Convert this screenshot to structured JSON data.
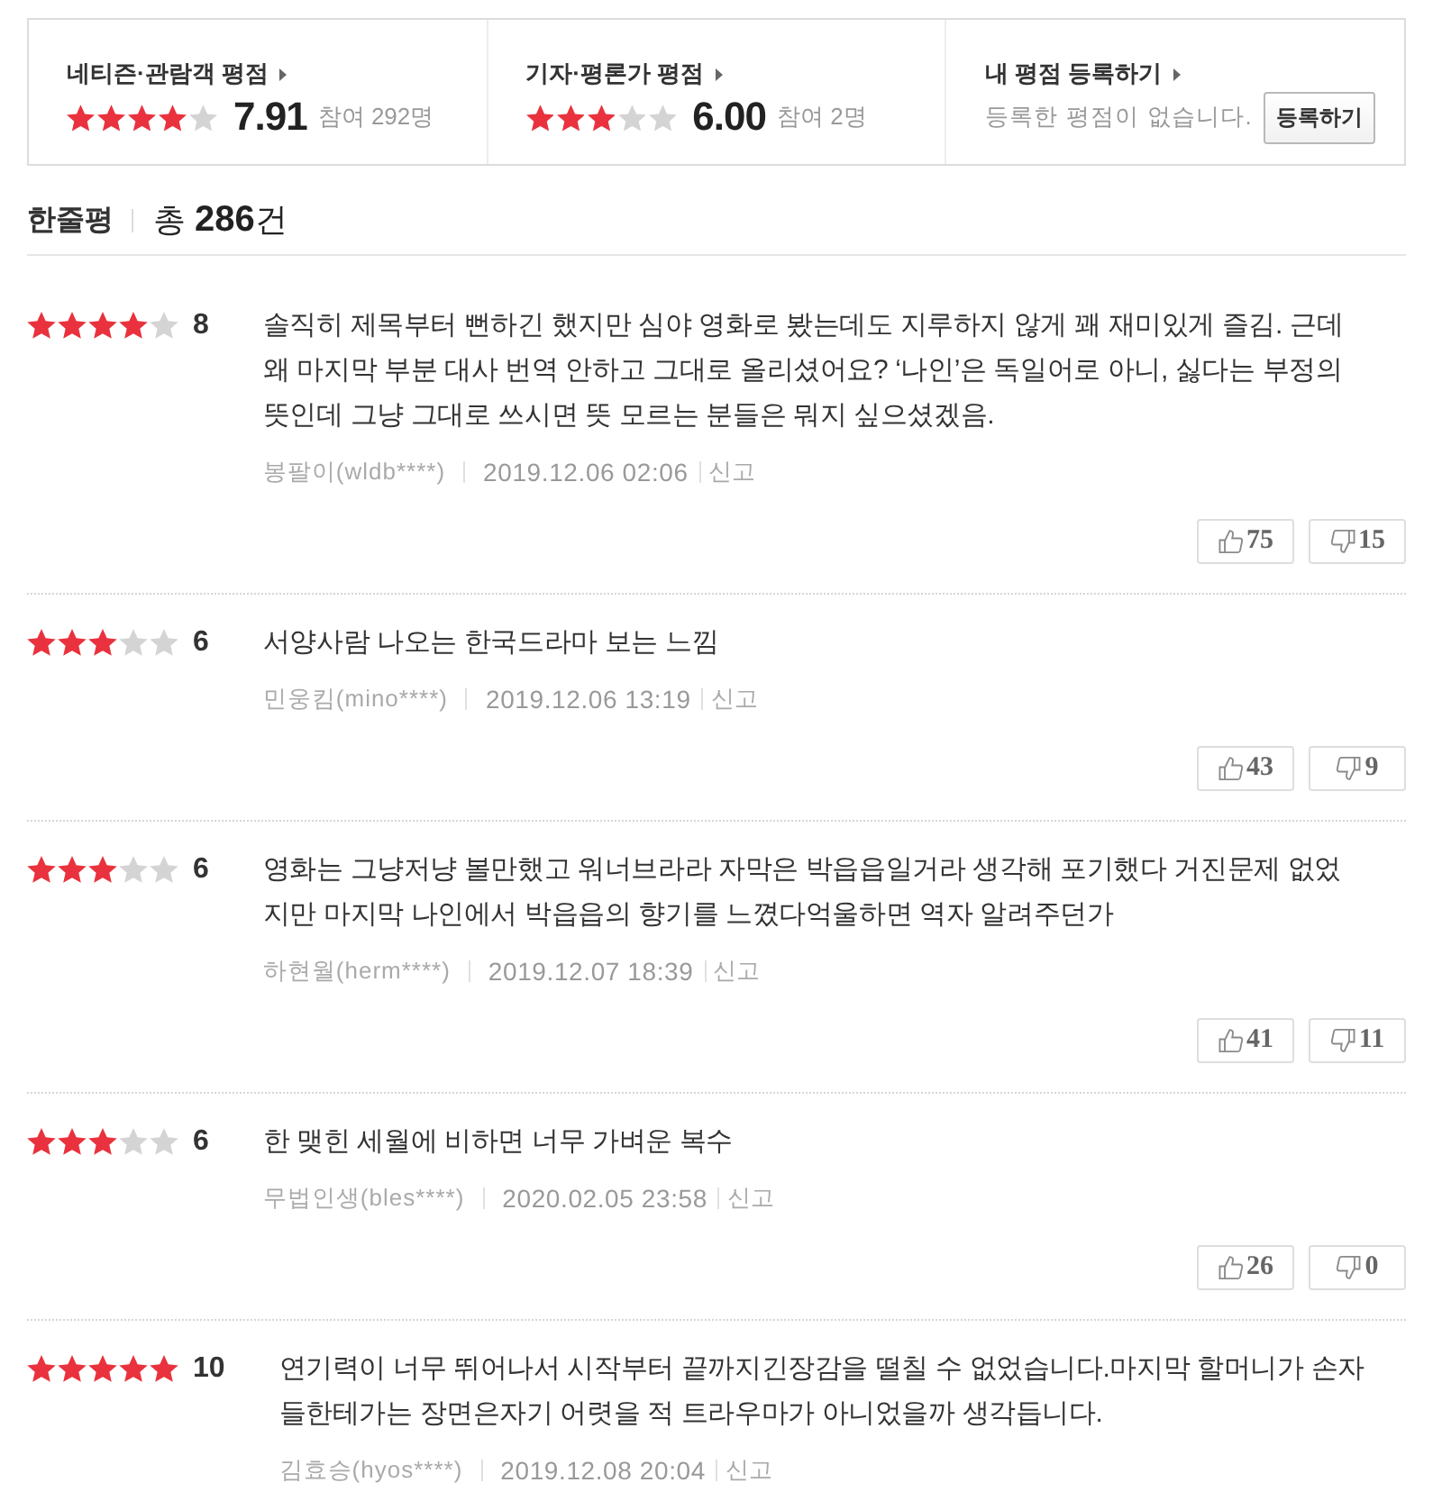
{
  "rating_summary": [
    {
      "title": "네티즌·관람객 평점",
      "stars": 4,
      "score": "7.91",
      "participants": "참여 292명"
    },
    {
      "title": "기자·평론가 평점",
      "stars": 3,
      "score": "6.00",
      "participants": "참여 2명"
    }
  ],
  "my_rating": {
    "title": "내 평점 등록하기",
    "message": "등록한 평점이 없습니다.",
    "button": "등록하기"
  },
  "reviews_header": {
    "title": "한줄평",
    "total": "총 **286**건"
  },
  "reviews": [
    {
      "stars": 4,
      "score": "8",
      "text": "솔직히 제목부터 뻔하긴 했지만 심야 영화로 봤는데도 지루하지 않게 꽤 재미있게 즐김. 근데 왜 마지막 부분 대사 번역 안하고 그대로 올리셨어요? ‘나인’은 독일어로 아니, 싫다는 부정의 뜻인데 그냥 그대로 쓰시면 뜻 모르는 분들은 뭐지 싶으셨겠음.",
      "author": "봉팔이(wldb****)",
      "date": "2019.12.06 02:06",
      "report": "신고",
      "likes": "75",
      "dislikes": "15"
    },
    {
      "stars": 3,
      "score": "6",
      "text": "서양사람 나오는 한국드라마 보는 느낌",
      "author": "민웅킴(mino****)",
      "date": "2019.12.06 13:19",
      "report": "신고",
      "likes": "43",
      "dislikes": "9"
    },
    {
      "stars": 3,
      "score": "6",
      "text": "영화는 그냥저냥 볼만했고 워너브라라 자막은 박읍읍일거라 생각해 포기했다 거진문제 없었지만 마지막 나인에서 박읍읍의 향기를 느꼈다억울하면 역자 알려주던가",
      "author": "하현월(herm****)",
      "date": "2019.12.07 18:39",
      "report": "신고",
      "likes": "41",
      "dislikes": "11"
    },
    {
      "stars": 3,
      "score": "6",
      "text": "한 맺힌 세월에 비하면 너무 가벼운 복수",
      "author": "무법인생(bles****)",
      "date": "2020.02.05 23:58",
      "report": "신고",
      "likes": "26",
      "dislikes": "0"
    },
    {
      "stars": 5,
      "score": "10",
      "text": "연기력이 너무 뛰어나서 시작부터 끝까지긴장감을 떨칠 수 없었습니다.마지막 할머니가 손자들한테가는 장면은자기 어렷을 적 트라우마가 아니었을까 생각듭니다.",
      "author": "김효승(hyos****)",
      "date": "2019.12.08 20:04",
      "report": "신고"
    }
  ]
}
